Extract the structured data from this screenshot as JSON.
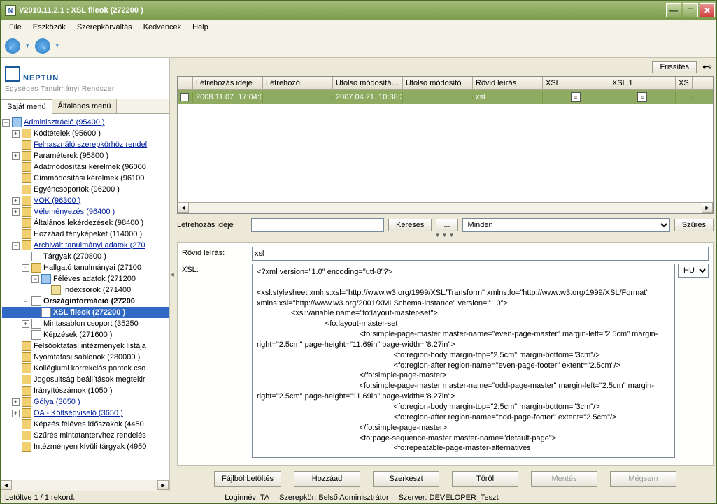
{
  "window": {
    "title": "V2010.11.2.1 : XSL fileok (272200  )",
    "icon_letter": "N"
  },
  "menu": [
    "File",
    "Eszközök",
    "Szerepkörváltás",
    "Kedvencek",
    "Help"
  ],
  "logo": {
    "main": "NEPTUN",
    "sub": "Egységes Tanulmányi Rendszer"
  },
  "tabs": {
    "a": "Saját menü",
    "b": "Általános menü"
  },
  "tree": {
    "root": "Adminisztráció (95400  )",
    "items": [
      "Kódtételek (95600  )",
      "Felhasználó szerepkörhöz rendel",
      "Paraméterek (95800  )",
      "Adatmódosítási kérelmek (96000",
      "Címmódosítási kérelmek (96100",
      "Egyéncsoportok (96200  )",
      "VOK (96300  )",
      "Véleményezés (96400  )",
      "Általános lekérdezések (98400  )",
      "Hozzáad fényképeket (114000  )"
    ],
    "arch": "Archivált tanulmányi adatok (270",
    "arch_children": {
      "targyak": "Tárgyak (270800  )",
      "hallgato": "Hallgató tanulmányai (27100",
      "feleves": "Féléves adatok (271200",
      "indexsorok": "Indexsorok (271400",
      "orszag": "Országinformáció (27200",
      "xsl": "XSL fileok (272200  )",
      "minta": "Mintasablon csoport (35250",
      "kepz": "Képzések (271600  )"
    },
    "rest": [
      "Felsőoktatási intézmények listája",
      "Nyomtatási sablonok (280000  )",
      "Kollégiumi korrekciós pontok cso",
      "Jogosultság beállítások megtekir",
      "Irányítószámok (1050  )",
      "Gólya (3050  )",
      "OA - Költségviselő (3650  )",
      "Képzés féléves időszakok (4450",
      "Szűrés mintatantervhez rendelés",
      "Intézményen kívüli tárgyak (4950"
    ]
  },
  "top_actions": {
    "refresh": "Frissítés"
  },
  "grid": {
    "cols": [
      "",
      "Létrehozás ideje",
      "Létrehozó",
      "Utolsó módosítás ...",
      "Utolsó módosító",
      "Rövid leírás",
      "XSL",
      "XSL 1",
      "XS"
    ],
    "row": {
      "letreh_ideje": "2008.11.07. 17:04:0",
      "utolso_mod": "2007.04.21. 10:38:3",
      "rovid": "xsl"
    }
  },
  "filter": {
    "label": "Létrehozás ideje",
    "search": "Keresés",
    "dots": "...",
    "all": "Minden",
    "szures": "Szűrés"
  },
  "detail": {
    "rovid_label": "Rövid leírás:",
    "rovid_value": "xsl",
    "xsl_label": "XSL:",
    "lang": "HU",
    "xsl_content": "<?xml version=\"1.0\" encoding=\"utf-8\"?>\n\n<xsl:stylesheet xmlns:xsl=\"http://www.w3.org/1999/XSL/Transform\" xmlns:fo=\"http://www.w3.org/1999/XSL/Format\" xmlns:xsi=\"http://www.w3.org/2001/XMLSchema-instance\" version=\"1.0\">\n                <xsl:variable name=\"fo:layout-master-set\">\n                                <fo:layout-master-set\n                                                <fo:simple-page-master master-name=\"even-page-master\" margin-left=\"2.5cm\" margin-right=\"2.5cm\" page-height=\"11.69in\" page-width=\"8.27in\">\n                                                                <fo:region-body margin-top=\"2.5cm\" margin-bottom=\"3cm\"/>\n                                                                <fo:region-after region-name=\"even-page-footer\" extent=\"2.5cm\"/>\n                                                </fo:simple-page-master>\n                                                <fo:simple-page-master master-name=\"odd-page-master\" margin-left=\"2.5cm\" margin-right=\"2.5cm\" page-height=\"11.69in\" page-width=\"8.27in\">\n                                                                <fo:region-body margin-top=\"2.5cm\" margin-bottom=\"3cm\"/>\n                                                                <fo:region-after region-name=\"odd-page-footer\" extent=\"2.5cm\"/>\n                                                </fo:simple-page-master>\n                                                <fo:page-sequence-master master-name=\"default-page\">\n                                                                <fo:repeatable-page-master-alternatives"
  },
  "buttons": {
    "load": "Fájlból betöltés",
    "add": "Hozzáad",
    "edit": "Szerkeszt",
    "del": "Töröl",
    "save": "Mentés",
    "cancel": "Mégsem"
  },
  "status": {
    "left": "Letöltve 1 / 1 rekord.",
    "login": "Loginnév: TA",
    "role": "Szerepkör: Belső Adminisztrátor",
    "server": "Szerver: DEVELOPER_Teszt"
  }
}
